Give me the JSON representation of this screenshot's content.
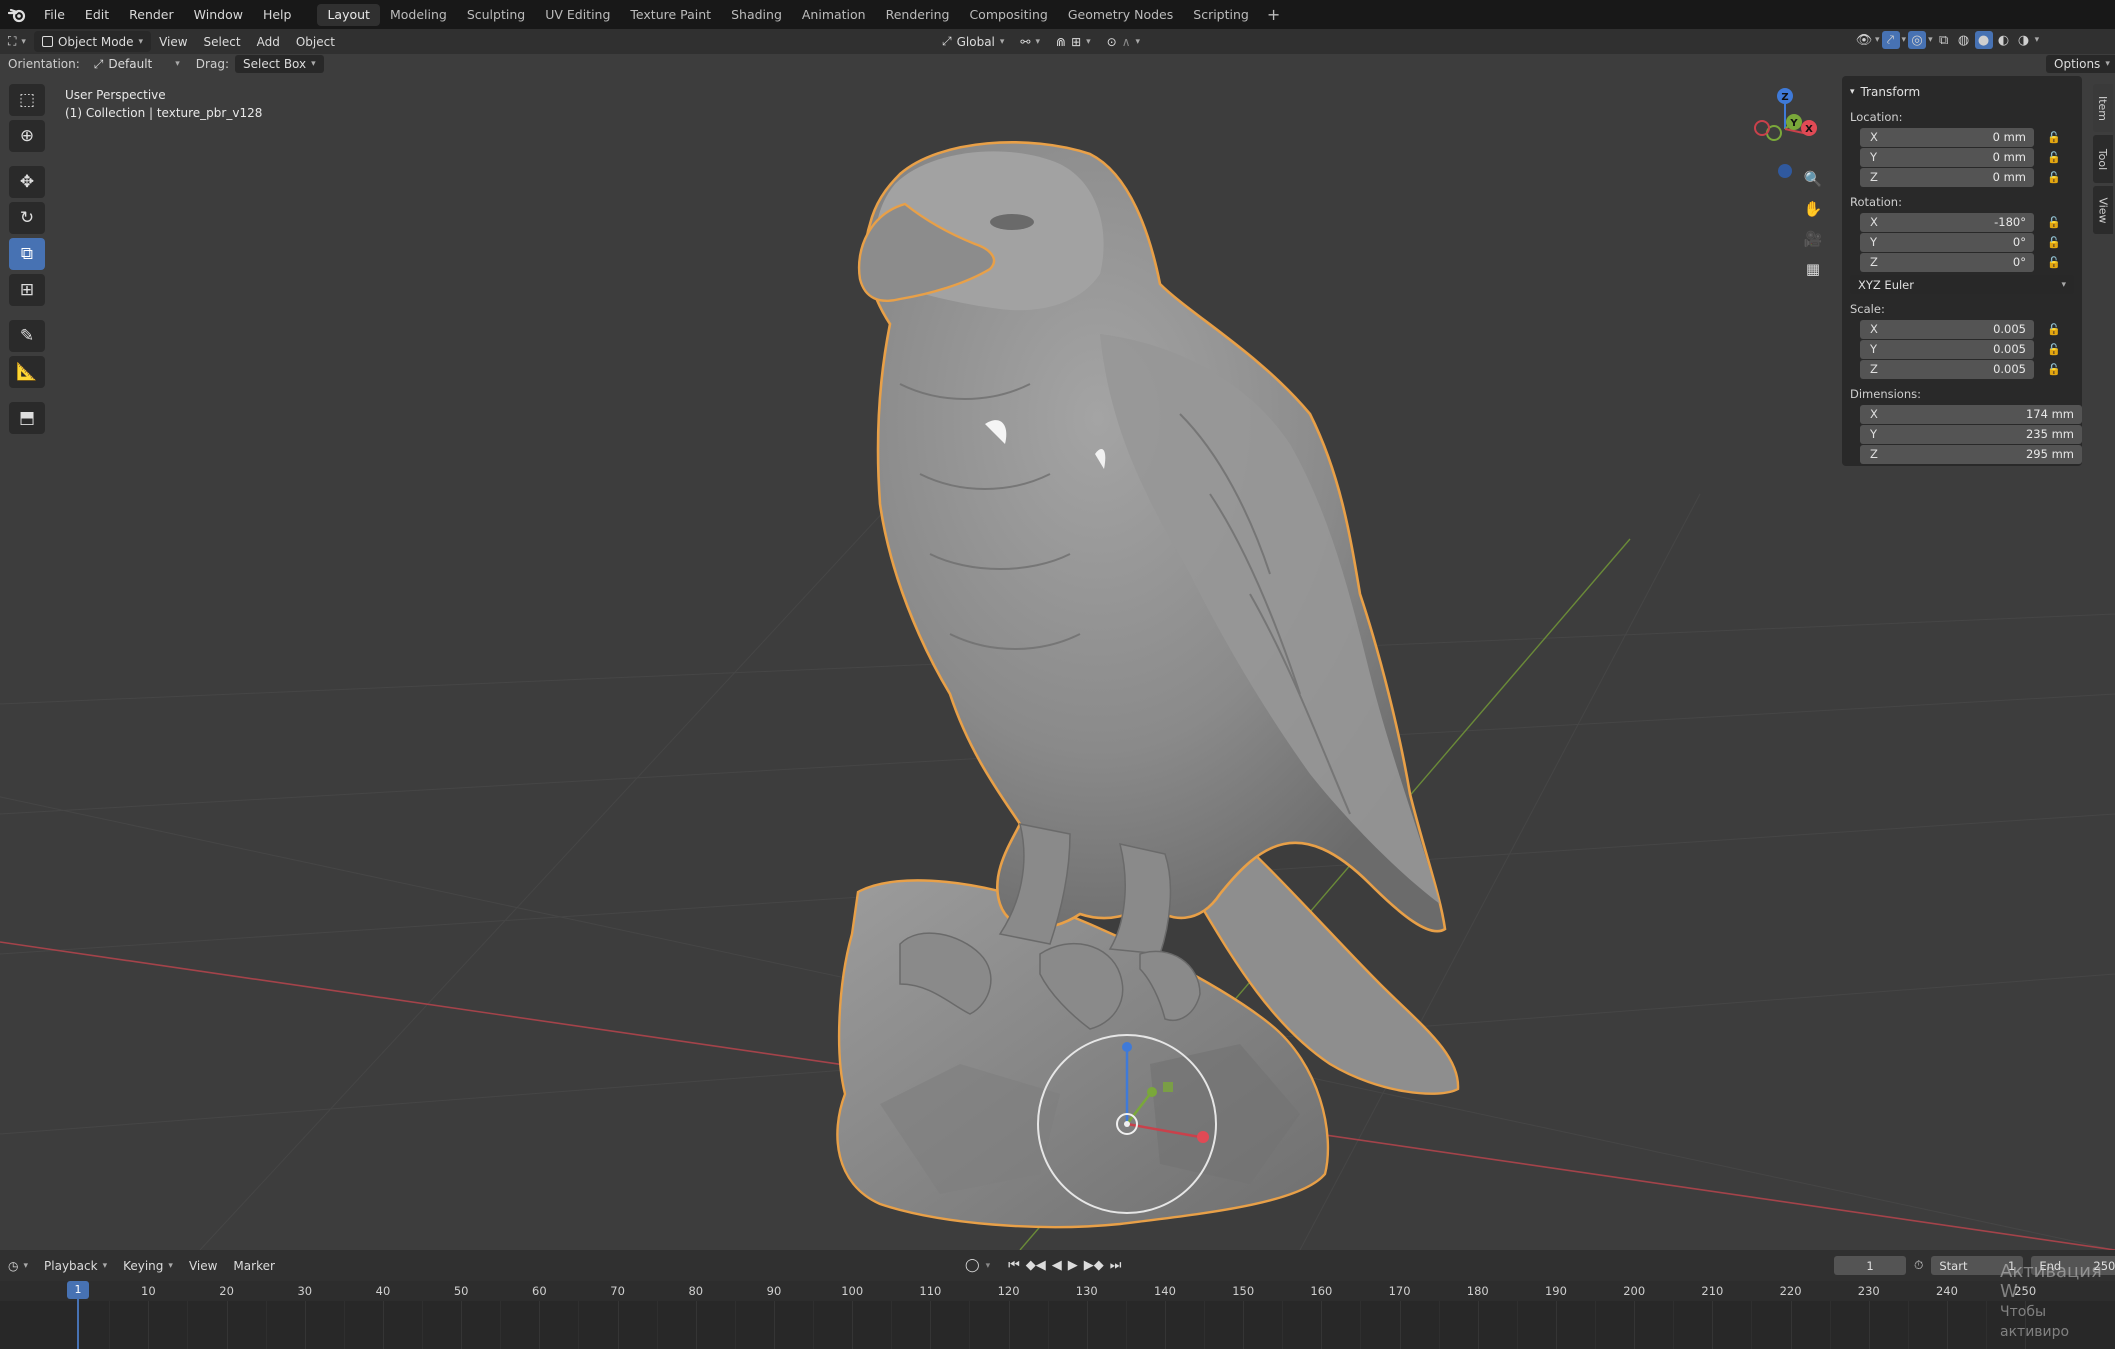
{
  "menu": {
    "items": [
      "File",
      "Edit",
      "Render",
      "Window",
      "Help"
    ]
  },
  "workspaces": [
    "Layout",
    "Modeling",
    "Sculpting",
    "UV Editing",
    "Texture Paint",
    "Shading",
    "Animation",
    "Rendering",
    "Compositing",
    "Geometry Nodes",
    "Scripting"
  ],
  "workspace_active": "Layout",
  "header": {
    "mode": "Object Mode",
    "menus": [
      "View",
      "Select",
      "Add",
      "Object"
    ],
    "transform_orientation": "Global",
    "options": "Options"
  },
  "tool_header": {
    "orientation_label": "Orientation:",
    "orientation_value": "Default",
    "drag_label": "Drag:",
    "drag_value": "Select Box"
  },
  "viewport": {
    "perspective": "User Perspective",
    "collection": "(1) Collection | texture_pbr_v128"
  },
  "nav_gizmo": {
    "z": "Z",
    "y": "Y",
    "x": "X"
  },
  "side_tabs": [
    "Item",
    "Tool",
    "View"
  ],
  "npanel": {
    "title": "Transform",
    "location_label": "Location:",
    "location": [
      {
        "axis": "X",
        "value": "0 mm"
      },
      {
        "axis": "Y",
        "value": "0 mm"
      },
      {
        "axis": "Z",
        "value": "0 mm"
      }
    ],
    "rotation_label": "Rotation:",
    "rotation": [
      {
        "axis": "X",
        "value": "-180°"
      },
      {
        "axis": "Y",
        "value": "0°"
      },
      {
        "axis": "Z",
        "value": "0°"
      }
    ],
    "rotation_mode": "XYZ Euler",
    "scale_label": "Scale:",
    "scale": [
      {
        "axis": "X",
        "value": "0.005"
      },
      {
        "axis": "Y",
        "value": "0.005"
      },
      {
        "axis": "Z",
        "value": "0.005"
      }
    ],
    "dimensions_label": "Dimensions:",
    "dimensions": [
      {
        "axis": "X",
        "value": "174 mm"
      },
      {
        "axis": "Y",
        "value": "235 mm"
      },
      {
        "axis": "Z",
        "value": "295 mm"
      }
    ]
  },
  "timeline": {
    "menus": [
      "Playback",
      "Keying",
      "View",
      "Marker"
    ],
    "current_frame": "1",
    "start_label": "Start",
    "start": "1",
    "end_label": "End",
    "end": "250",
    "ruler": [
      "10",
      "20",
      "30",
      "40",
      "50",
      "60",
      "70",
      "80",
      "90",
      "100",
      "110",
      "120",
      "130",
      "140",
      "150",
      "160",
      "170",
      "180",
      "190",
      "200",
      "210",
      "220",
      "230",
      "240",
      "250"
    ],
    "playhead": "1"
  },
  "watermark": {
    "line1": "Активация W",
    "line2": "Чтобы активиро"
  },
  "colors": {
    "accent": "#4772b3",
    "selection_outline": "#e8a048",
    "axis_x": "#c9414b",
    "axis_y": "#7aa83a",
    "axis_z": "#3f7ad8"
  }
}
